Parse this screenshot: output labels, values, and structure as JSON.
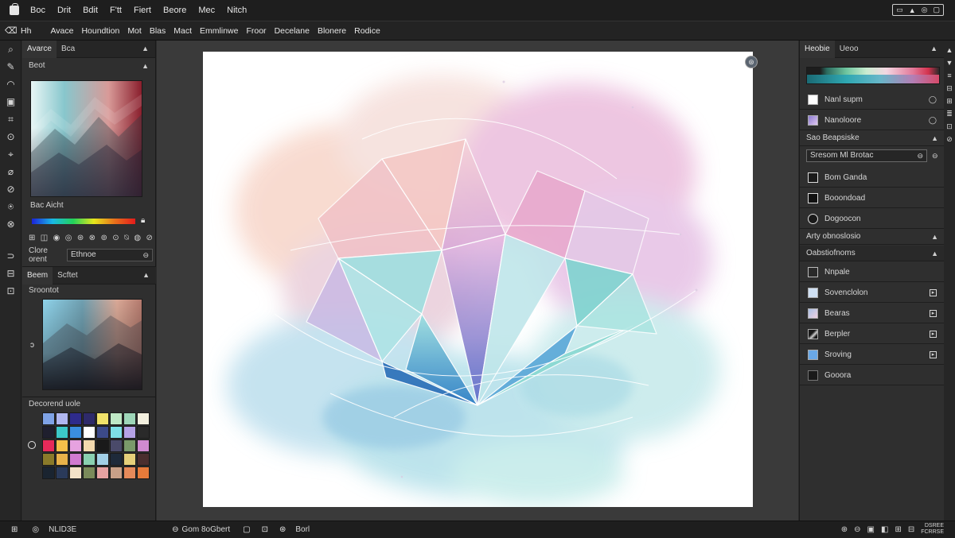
{
  "menubar": {
    "items": [
      "Boc",
      "Drit",
      "Bdit",
      "F'tt",
      "Fiert",
      "Beore",
      "Mec",
      "Nitch"
    ],
    "window_controls": [
      "▭",
      "▲",
      "◎",
      "▢"
    ]
  },
  "optionsbar": {
    "icons": [
      "⌫",
      "Hh"
    ],
    "items": [
      "Avace",
      "Houndtion",
      "Mot",
      "Blas",
      "Mact",
      "Emmlinwe",
      "Froor",
      "Decelane",
      "Blonere",
      "Rodice"
    ]
  },
  "tools": [
    "⌕",
    "✎",
    "◠",
    "▣",
    "⌗",
    "⊙",
    "⌖",
    "⌀",
    "⊘",
    "⍟",
    "⊗",
    "",
    "⊃",
    "⊟",
    "⊡"
  ],
  "left_panel": {
    "tabs": [
      "Avarce",
      "Bca"
    ],
    "section1_label": "Beot",
    "swatch_label": "Bac Aicht",
    "icon_row": [
      "⊞",
      "◫",
      "◉",
      "◎",
      "⊛",
      "⊗",
      "⊚",
      "⊙",
      "⍉",
      "◍",
      "⊘"
    ],
    "color_field_label": "Clore orent",
    "color_field_value": "Ethnoe",
    "tabs2": [
      "Beem",
      "Scftet"
    ],
    "section2_label": "Sroontot",
    "small_c": "ↄ",
    "recent_label": "Decorend uole",
    "swatches": [
      "#7fa3e6",
      "#b0b7f0",
      "#2e2b8c",
      "#2e2a6a",
      "#f1e26a",
      "#bfe8c5",
      "#9ed6b8",
      "#f3f0df",
      "#1f1f2e",
      "#3cc8c8",
      "#3a8fe0",
      "#ffffff",
      "#3c4a8a",
      "#7ee0e6",
      "#b5a2e6",
      "#2a2a2a",
      "#e62a5a",
      "#f5c04a",
      "#e6a2e0",
      "#f3d9ae",
      "#1a1a1a",
      "#4a4a6a",
      "#7a9a6a",
      "#d08ad0",
      "#8a7a2a",
      "#e8b24a",
      "#d07ad0",
      "#8ad0b0",
      "#a2d0e6",
      "#1e2a3a",
      "#e6d07a",
      "#4a2e2e",
      "#1a2430",
      "#2a3a5a",
      "#f3e2c8",
      "#7a8a5a",
      "#e6a2a2",
      "#c8a088",
      "#e68a5a",
      "#e67a3a"
    ]
  },
  "canvas": {
    "badge": "⊛"
  },
  "right_panel": {
    "tabs": [
      "Heobie",
      "Ueoo"
    ],
    "layers_top": [
      {
        "name": "Nanl supm",
        "icon": "◯",
        "thumb": "#ffffff"
      },
      {
        "name": "Nanoloore",
        "icon": "◯",
        "thumb": "#8a7ad0"
      }
    ],
    "section_a": "Sao Beapsiske",
    "search_value": "Sresom Ml Brotac",
    "search_chev": "⊖",
    "eye": "⊖",
    "layers_mid": [
      {
        "name": "Bom Ganda",
        "thumb": "#1a1a1a"
      },
      {
        "name": "Booondoad",
        "thumb": "#111111"
      },
      {
        "name": "Dogoocon",
        "thumb": "#1a1a1a"
      }
    ],
    "section_b": "Arty obnoslosio",
    "section_c": "Oabstiofnoms",
    "layers_bottom": [
      {
        "name": "Nnpale",
        "thumb": "#2a2a2a",
        "rt": ""
      },
      {
        "name": "Sovenclolon",
        "thumb": "#cfe0f3",
        "rt": "▸"
      },
      {
        "name": "Bearas",
        "thumb": "#a8c0e6",
        "rt": "▸"
      },
      {
        "name": "Berpler",
        "thumb": "#1a1a1a",
        "rt": "▸"
      },
      {
        "name": "Sroving",
        "thumb": "#6aa8e6",
        "rt": "▸"
      },
      {
        "name": "Gooora",
        "thumb": "#1a1a1a",
        "rt": ""
      }
    ],
    "scroll_icons": [
      "▲",
      "▼",
      "≡",
      "⊟",
      "⊞",
      "≣",
      "⊡",
      "⊘"
    ]
  },
  "statusbar": {
    "icons": [
      "⊞",
      "◎"
    ],
    "zoom": "NLID3E",
    "doc_icon": "⊖",
    "doc": "Gom 8oGbert",
    "icons2": [
      "▢",
      "⊡",
      "⊛"
    ],
    "mode": "Borl",
    "right_icons": [
      "⊕",
      "⊖",
      "▣",
      "◧",
      "⊞",
      "⊟"
    ],
    "right_text1": "DSREE",
    "right_text2": "FCRRSE"
  },
  "colors": {
    "background": "#2b2b2b",
    "panel": "#2f2f2f",
    "menubar": "#1e1e1e",
    "canvas": "#ffffff"
  }
}
